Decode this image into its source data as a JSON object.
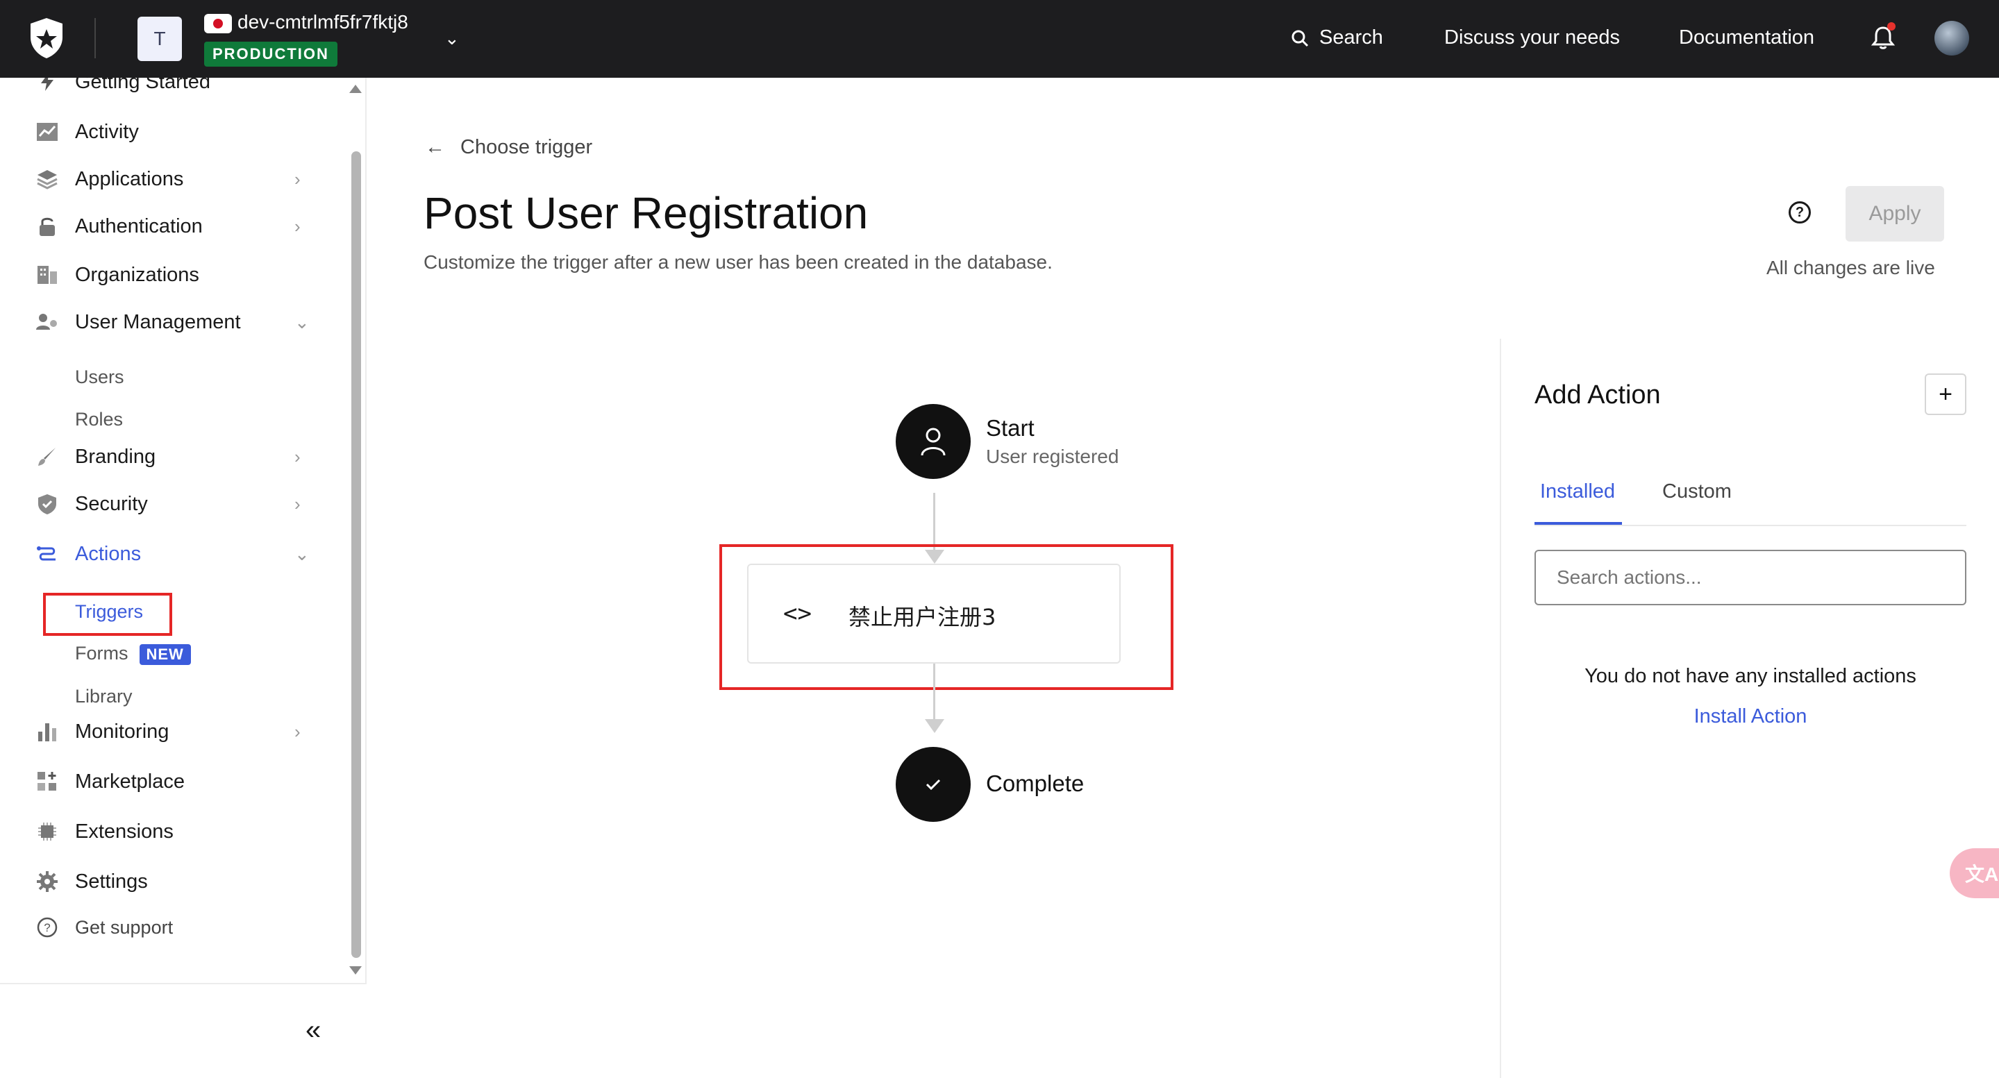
{
  "topbar": {
    "tenant_initial": "T",
    "tenant_name": "dev-cmtrlmf5fr7fktj8",
    "environment": "PRODUCTION",
    "search_label": "Search",
    "discuss_label": "Discuss your needs",
    "docs_label": "Documentation"
  },
  "sidebar": {
    "items": [
      {
        "label": "Getting Started",
        "icon": "bolt-icon"
      },
      {
        "label": "Activity",
        "icon": "activity-icon"
      },
      {
        "label": "Applications",
        "icon": "layers-icon"
      },
      {
        "label": "Authentication",
        "icon": "lock-icon"
      },
      {
        "label": "Organizations",
        "icon": "building-icon"
      },
      {
        "label": "User Management",
        "icon": "users-icon"
      },
      {
        "label": "Branding",
        "icon": "brush-icon"
      },
      {
        "label": "Security",
        "icon": "shield-icon"
      },
      {
        "label": "Actions",
        "icon": "actions-icon"
      },
      {
        "label": "Monitoring",
        "icon": "bar-chart-icon"
      },
      {
        "label": "Marketplace",
        "icon": "grid-plus-icon"
      },
      {
        "label": "Extensions",
        "icon": "chip-icon"
      },
      {
        "label": "Settings",
        "icon": "gear-icon"
      },
      {
        "label": "Get support",
        "icon": "help-icon"
      }
    ],
    "user_management_sub": [
      "Users",
      "Roles"
    ],
    "actions_sub": {
      "triggers": "Triggers",
      "forms": "Forms",
      "forms_badge": "NEW",
      "library": "Library"
    }
  },
  "main": {
    "back_label": "Choose trigger",
    "title": "Post User Registration",
    "subtitle": "Customize the trigger after a new user has been created in the database.",
    "apply_label": "Apply",
    "live_status": "All changes are live"
  },
  "flow": {
    "start_title": "Start",
    "start_sub": "User registered",
    "action_name": "禁止用户注册3",
    "complete_title": "Complete"
  },
  "panel": {
    "title": "Add Action",
    "tabs": [
      "Installed",
      "Custom"
    ],
    "search_placeholder": "Search actions...",
    "empty_text": "You do not have any installed actions",
    "install_link": "Install Action"
  },
  "colors": {
    "accent": "#3b5bdb",
    "topbar_bg": "#1d1d1f",
    "production_badge": "#0f7a3a",
    "highlight": "#e52626"
  }
}
